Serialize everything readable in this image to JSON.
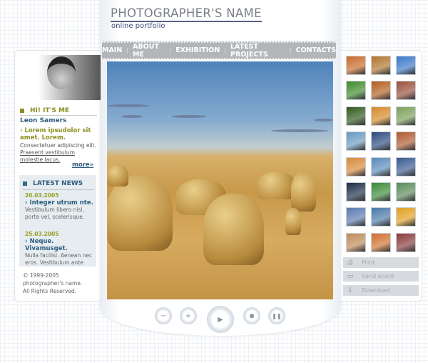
{
  "header": {
    "title": "PHOTOGRAPHER'S NAME",
    "subtitle": "online portfolio"
  },
  "nav": [
    "MAIN",
    "ABOUT ME",
    "EXHIBITION",
    "LATEST PROJECTS",
    "CONTACTS"
  ],
  "about": {
    "heading": "HI! IT'S ME",
    "name": "Leon Samers",
    "lead": "Lorem ipsudolor sit amet. Lorem.",
    "text": "Consectetuer adipiscing elit.",
    "link": "Praesent vestibulum molestie lacus.",
    "more": "more"
  },
  "news": {
    "heading": "LATEST NEWS",
    "items": [
      {
        "date": "20.03.2005",
        "title": "Integer utrum nte.",
        "text": "Vestibulum libero nisl, porta vel, scelerisque."
      },
      {
        "date": "25.03.2005",
        "title": "Neque. Vivamusget.",
        "text": "Nulla facilisi. Aenean nec eros. Vestibulum ante"
      }
    ]
  },
  "footer": {
    "copyright": "© 1999-2005 photographer's name. All Rights Reserved."
  },
  "actions": [
    {
      "label": "Print",
      "icon": "printer-icon"
    },
    {
      "label": "Send ecard",
      "icon": "ecard-icon"
    },
    {
      "label": "Download",
      "icon": "download-icon"
    }
  ],
  "thumbnails": [
    "#c86a2a",
    "#b0752e",
    "#3b78c8",
    "#3f8a2c",
    "#b25f1f",
    "#9a4f3c",
    "#2f5a1c",
    "#d48a2a",
    "#7aa05a",
    "#6a9ac0",
    "#2c4a80",
    "#b05a30",
    "#d88a3a",
    "#5a8aba",
    "#3a5a90",
    "#1c2c48",
    "#3a8a3a",
    "#5a8a5a",
    "#5a7ab0",
    "#4a7aa8",
    "#e0a020",
    "#c08a5a",
    "#d07030",
    "#8a3a3a"
  ],
  "controls": [
    "minus",
    "plus",
    "play",
    "stop",
    "pause"
  ],
  "colors": {
    "olive": "#8a8f1e",
    "blue": "#2d5e7e",
    "nav": "#b3b6b9"
  }
}
